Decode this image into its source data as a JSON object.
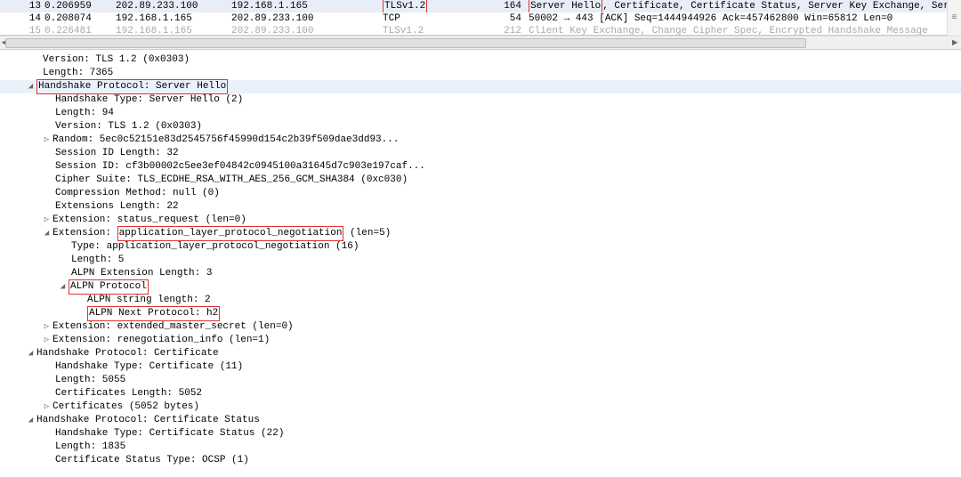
{
  "packets": [
    {
      "num": "13",
      "time": "0.206959",
      "src": "202.89.233.100",
      "dst": "192.168.1.165",
      "proto": "TLSv1.2",
      "len": "164",
      "info_prefix": "Server Hello",
      "info_rest": ", Certificate, Certificate Status, Server Key Exchange, Serve",
      "highlight": true,
      "selected": true
    },
    {
      "num": "14",
      "time": "0.208074",
      "src": "192.168.1.165",
      "dst": "202.89.233.100",
      "proto": "TCP",
      "len": "54",
      "info_prefix": "50002 → 443 [ACK] Seq=1444944926 Ack=457462800 Win=65812 Len=0",
      "info_rest": "",
      "highlight": false,
      "selected": false
    }
  ],
  "packet_partial": {
    "num": "15",
    "time": "0.226481",
    "src": "192.168.1.165",
    "dst": "202.89.233.100",
    "proto": "TLSv1.2",
    "len": "212",
    "info": "Client Key Exchange, Change Cipher Spec, Encrypted Handshake Message"
  },
  "tree": {
    "version": "Version: TLS 1.2 (0x0303)",
    "length": "Length: 7365",
    "hs_server_hello": "Handshake Protocol: Server Hello",
    "ht_server_hello": "Handshake Type: Server Hello (2)",
    "len94": "Length: 94",
    "ver12": "Version: TLS 1.2 (0x0303)",
    "random": "Random: 5ec0c52151e83d2545756f45990d154c2b39f509dae3dd93...",
    "sid_len": "Session ID Length: 32",
    "sid": "Session ID: cf3b00002c5ee3ef04842c0945100a31645d7c903e197caf...",
    "cipher": "Cipher Suite: TLS_ECDHE_RSA_WITH_AES_256_GCM_SHA384 (0xc030)",
    "comp": "Compression Method: null (0)",
    "ext_len": "Extensions Length: 22",
    "ext_status": "Extension: status_request (len=0)",
    "ext_alpn_pre": "Extension: ",
    "ext_alpn_hl": "application_layer_protocol_negotiation",
    "ext_alpn_suf": " (len=5)",
    "alpn_type": "Type: application_layer_protocol_negotiation (16)",
    "alpn_len5": "Length: 5",
    "alpn_ext_len": "ALPN Extension Length: 3",
    "alpn_proto": "ALPN Protocol",
    "alpn_str_len": "ALPN string length: 2",
    "alpn_next": "ALPN Next Protocol: h2",
    "ext_ems": "Extension: extended_master_secret (len=0)",
    "ext_reneg": "Extension: renegotiation_info (len=1)",
    "hs_cert": "Handshake Protocol: Certificate",
    "ht_cert": "Handshake Type: Certificate (11)",
    "len5055": "Length: 5055",
    "certs_len": "Certificates Length: 5052",
    "certs": "Certificates (5052 bytes)",
    "hs_certstat": "Handshake Protocol: Certificate Status",
    "ht_certstat": "Handshake Type: Certificate Status (22)",
    "len1835": "Length: 1835",
    "certstat_type": "Certificate Status Type: OCSP (1)"
  },
  "glyphs": {
    "open": "◢",
    "closed": "▷"
  }
}
